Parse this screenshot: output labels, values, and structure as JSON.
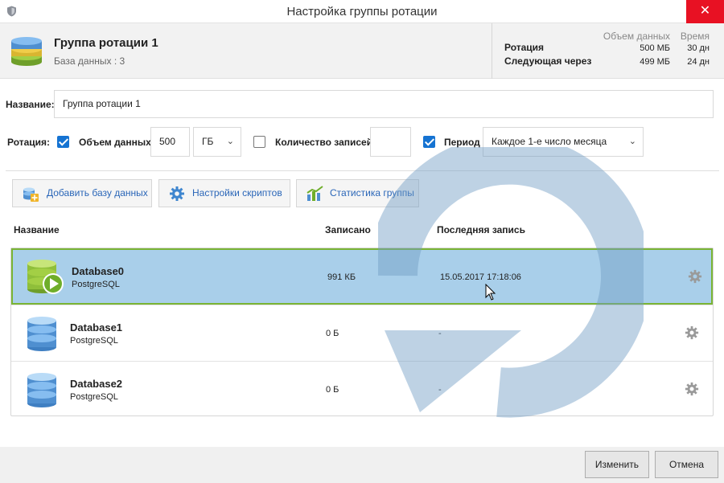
{
  "window": {
    "title": "Настройка группы ротации",
    "close_glyph": "✕"
  },
  "header": {
    "group_name": "Группа ротации 1",
    "db_count": "База данных :  3",
    "stats": {
      "col_data": "Объем данных",
      "col_time": "Время",
      "rotation_label": "Ротация",
      "rotation_data": "500 МБ",
      "rotation_time": "30 дн",
      "next_label": "Следующая через",
      "next_data": "499 МБ",
      "next_time": "24 дн"
    }
  },
  "form": {
    "name_label": "Название:",
    "name_value": "Группа ротации 1",
    "rotation_label": "Ротация:",
    "data_volume": {
      "label": "Объем данных",
      "checked": true,
      "value": "500",
      "unit": "ГБ"
    },
    "records": {
      "label": "Количество записей",
      "checked": false,
      "value": ""
    },
    "period": {
      "label": "Период",
      "checked": true,
      "value": "Каждое 1-е число месяца"
    }
  },
  "toolbar": {
    "add_db": "Добавить базу данных",
    "scripts": "Настройки скриптов",
    "stats": "Статистика группы"
  },
  "table": {
    "columns": {
      "name": "Название",
      "written": "Записано",
      "last": "Последняя запись"
    },
    "rows": [
      {
        "name": "Database0",
        "type": "PostgreSQL",
        "written": "991 КБ",
        "last": "15.05.2017 17:18:06",
        "selected": true,
        "active": true
      },
      {
        "name": "Database1",
        "type": "PostgreSQL",
        "written": "0 Б",
        "last": "-",
        "selected": false,
        "active": false
      },
      {
        "name": "Database2",
        "type": "PostgreSQL",
        "written": "0 Б",
        "last": "-",
        "selected": false,
        "active": false
      }
    ]
  },
  "footer": {
    "edit": "Изменить",
    "cancel": "Отмена"
  },
  "colors": {
    "accent": "#1573d2",
    "selection": "#a9cfea",
    "selection_border": "#7ab435",
    "close": "#e81123",
    "link": "#2a66b8"
  }
}
